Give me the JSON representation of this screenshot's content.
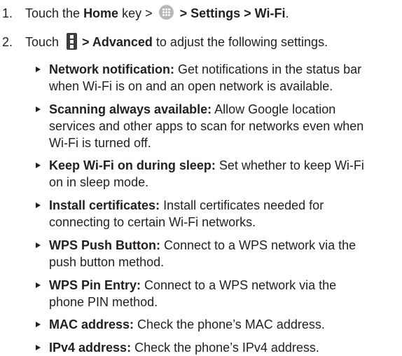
{
  "steps": [
    {
      "number": "1.",
      "text_a": "Touch the ",
      "bold_a": "Home",
      "text_b": " key > ",
      "icon_a": "apps-icon",
      "text_c": " > ",
      "bold_b": "Settings > Wi-Fi",
      "text_d": "."
    },
    {
      "number": "2.",
      "text_a": "Touch ",
      "icon_a": "menu-icon",
      "bold_a": "> Advanced",
      "text_b": " to adjust the following settings."
    }
  ],
  "bullets": [
    {
      "term": "Network notification:",
      "line1": " Get notifications in the status bar",
      "line2": "when Wi-Fi is on and an open network is available."
    },
    {
      "term": "Scanning always available:",
      "line1": " Allow Google location",
      "line2": "services and other apps to scan for networks even when",
      "line3": "Wi-Fi is turned off."
    },
    {
      "term": "Keep Wi-Fi on during sleep:",
      "line1": " Set whether to keep Wi-Fi",
      "line2": "on in sleep mode."
    },
    {
      "term": "Install certificates:",
      "line1": " Install certificates needed for",
      "line2": "connecting to certain Wi-Fi networks."
    },
    {
      "term": "WPS Push Button:",
      "line1": " Connect to a WPS network via the",
      "line2": "push button method."
    },
    {
      "term": "WPS Pin Entry:",
      "line1": " Connect to a WPS network via the",
      "line2": "phone PIN method."
    },
    {
      "term": "MAC address:",
      "line1": " Check the phone’s MAC address."
    },
    {
      "term": "IPv4 address:",
      "line1": " Check the phone’s IPv4 address."
    }
  ]
}
